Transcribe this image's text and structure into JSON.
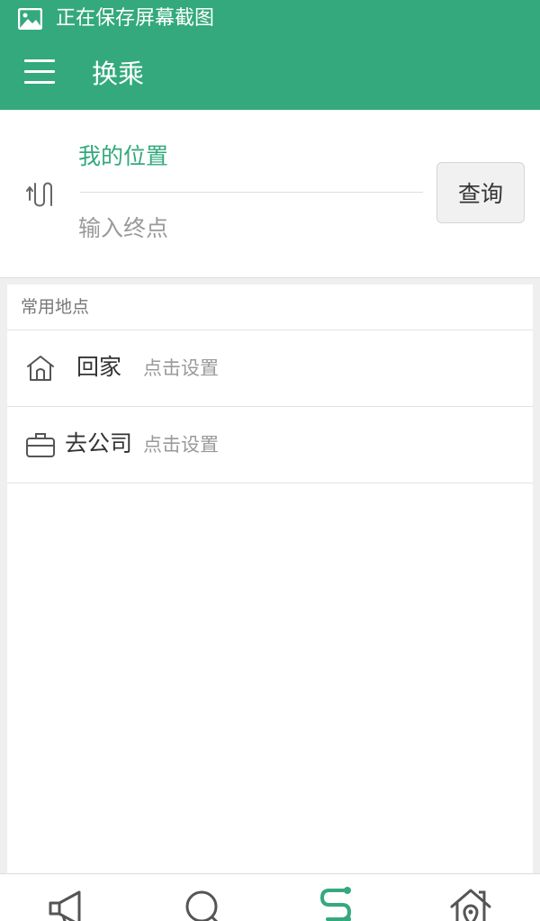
{
  "status_bar": {
    "notification_text": "正在保存屏幕截图",
    "icon": "image-icon"
  },
  "app_bar": {
    "title": "换乘",
    "menu_icon": "menu-icon"
  },
  "route": {
    "start_value": "我的位置",
    "end_placeholder": "输入终点",
    "query_label": "查询",
    "swap_icon": "swap-icon"
  },
  "frequent_places": {
    "header": "常用地点",
    "items": [
      {
        "name": "回家",
        "hint": "点击设置",
        "icon": "home-icon"
      },
      {
        "name": "去公司",
        "hint": "点击设置",
        "icon": "briefcase-icon"
      }
    ]
  },
  "bottom_nav": {
    "items": [
      {
        "icon": "megaphone-icon",
        "active": false
      },
      {
        "icon": "search-icon",
        "active": false
      },
      {
        "icon": "route-icon",
        "active": true
      },
      {
        "icon": "home-location-icon",
        "active": false
      }
    ]
  },
  "colors": {
    "accent": "#33a97d",
    "background": "#efefef",
    "text_primary": "#333333",
    "text_secondary": "#9a9a9a"
  }
}
